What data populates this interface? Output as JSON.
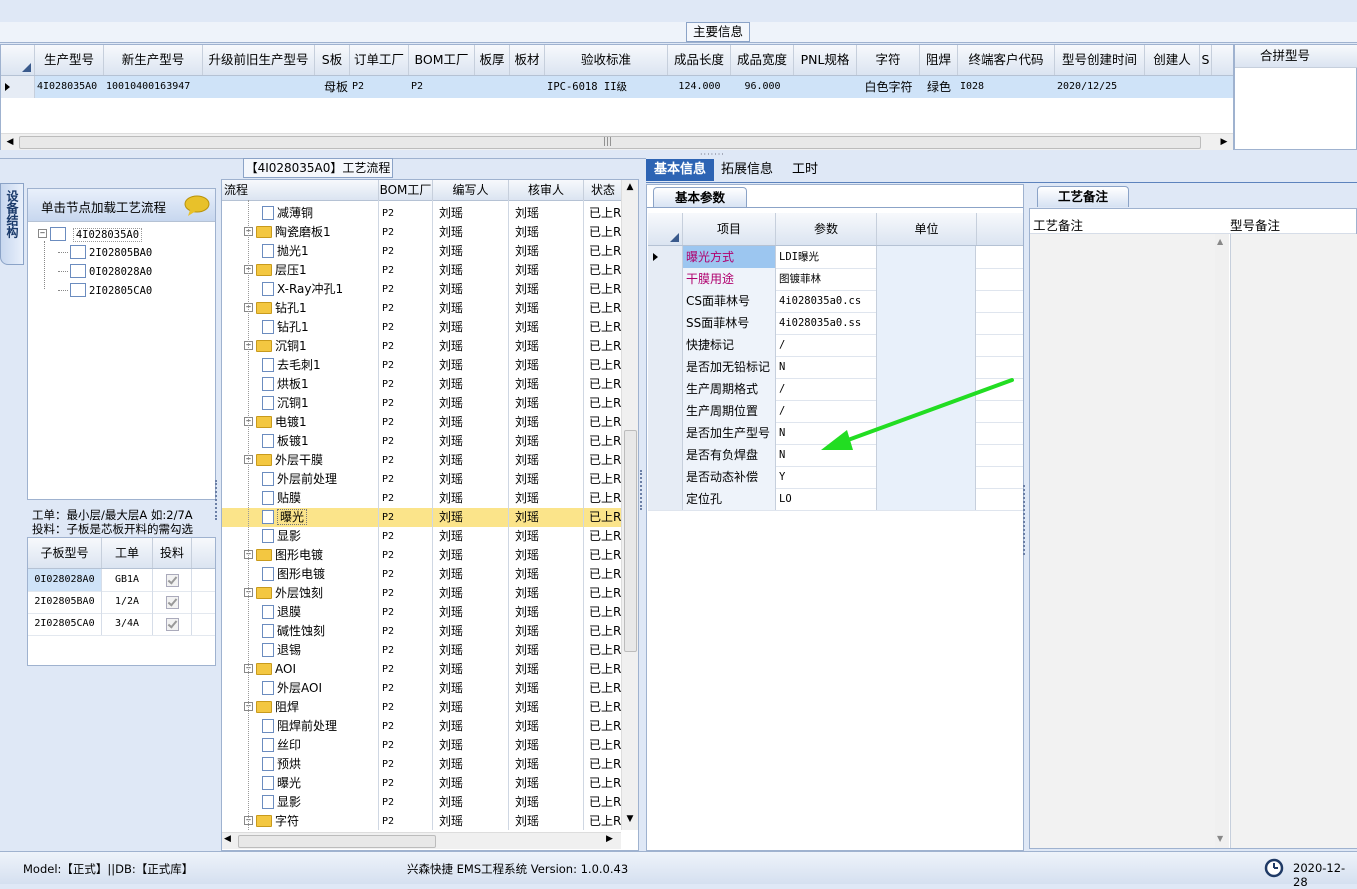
{
  "top": {
    "main_info_label": "主要信息",
    "columns": [
      "生产型号",
      "新生产型号",
      "升级前旧生产型号",
      "S板",
      "订单工厂",
      "BOM工厂",
      "板厚",
      "板材",
      "验收标准",
      "成品长度",
      "成品宽度",
      "PNL规格",
      "字符",
      "阻焊",
      "终端客户代码",
      "型号创建时间",
      "创建人",
      "S"
    ],
    "row": [
      "4I028035A0",
      "10010400163947",
      "",
      "母板",
      "P2",
      "P2",
      "",
      "",
      "IPC-6018 II级",
      "124.000",
      "96.000",
      "",
      "白色字符",
      "绿色",
      "I028",
      "2020/12/25",
      "",
      ""
    ],
    "merge_header": "合拼型号"
  },
  "left": {
    "vertical_tab": "设备结构",
    "hint": "单击节点加载工艺流程",
    "tree_root": "4I028035A0",
    "tree_children": [
      "2I02805BA0",
      "0I028028A0",
      "2I02805CA0"
    ],
    "note_line1": "工单：最小层/最大层A 如:2/7A",
    "note_line2": "投料：子板是芯板开料的需勾选",
    "sub_headers": [
      "子板型号",
      "工单",
      "投料"
    ],
    "sub_rows": [
      {
        "model": "0I028028A0",
        "order": "GB1A"
      },
      {
        "model": "2I02805BA0",
        "order": "1/2A"
      },
      {
        "model": "2I02805CA0",
        "order": "3/4A"
      }
    ]
  },
  "process": {
    "title": "【4I028035A0】工艺流程",
    "headers": [
      "流程",
      "BOM工厂",
      "编写人",
      "核审人",
      "状态"
    ],
    "rows": [
      {
        "kind": "child",
        "name": "减薄铜",
        "bom": "P2",
        "writer": "刘瑶",
        "reviewer": "刘瑶",
        "status": "已上R"
      },
      {
        "kind": "folder",
        "name": "陶瓷磨板1",
        "bom": "P2",
        "writer": "刘瑶",
        "reviewer": "刘瑶",
        "status": "已上R"
      },
      {
        "kind": "child",
        "name": "抛光1",
        "bom": "P2",
        "writer": "刘瑶",
        "reviewer": "刘瑶",
        "status": "已上R"
      },
      {
        "kind": "folder",
        "name": "层压1",
        "bom": "P2",
        "writer": "刘瑶",
        "reviewer": "刘瑶",
        "status": "已上R"
      },
      {
        "kind": "child",
        "name": "X-Ray冲孔1",
        "bom": "P2",
        "writer": "刘瑶",
        "reviewer": "刘瑶",
        "status": "已上R"
      },
      {
        "kind": "folder",
        "name": "钻孔1",
        "bom": "P2",
        "writer": "刘瑶",
        "reviewer": "刘瑶",
        "status": "已上R"
      },
      {
        "kind": "child",
        "name": "钻孔1",
        "bom": "P2",
        "writer": "刘瑶",
        "reviewer": "刘瑶",
        "status": "已上R"
      },
      {
        "kind": "folder",
        "name": "沉铜1",
        "bom": "P2",
        "writer": "刘瑶",
        "reviewer": "刘瑶",
        "status": "已上R"
      },
      {
        "kind": "child",
        "name": "去毛刺1",
        "bom": "P2",
        "writer": "刘瑶",
        "reviewer": "刘瑶",
        "status": "已上R"
      },
      {
        "kind": "child",
        "name": "烘板1",
        "bom": "P2",
        "writer": "刘瑶",
        "reviewer": "刘瑶",
        "status": "已上R"
      },
      {
        "kind": "child",
        "name": "沉铜1",
        "bom": "P2",
        "writer": "刘瑶",
        "reviewer": "刘瑶",
        "status": "已上R"
      },
      {
        "kind": "folder",
        "name": "电镀1",
        "bom": "P2",
        "writer": "刘瑶",
        "reviewer": "刘瑶",
        "status": "已上R"
      },
      {
        "kind": "child",
        "name": "板镀1",
        "bom": "P2",
        "writer": "刘瑶",
        "reviewer": "刘瑶",
        "status": "已上R"
      },
      {
        "kind": "folder",
        "name": "外层干膜",
        "bom": "P2",
        "writer": "刘瑶",
        "reviewer": "刘瑶",
        "status": "已上R"
      },
      {
        "kind": "child",
        "name": "外层前处理",
        "bom": "P2",
        "writer": "刘瑶",
        "reviewer": "刘瑶",
        "status": "已上R"
      },
      {
        "kind": "child",
        "name": "贴膜",
        "bom": "P2",
        "writer": "刘瑶",
        "reviewer": "刘瑶",
        "status": "已上R"
      },
      {
        "kind": "child",
        "name": "曝光",
        "bom": "P2",
        "writer": "刘瑶",
        "reviewer": "刘瑶",
        "status": "已上R"
      },
      {
        "kind": "child",
        "name": "显影",
        "bom": "P2",
        "writer": "刘瑶",
        "reviewer": "刘瑶",
        "status": "已上R"
      },
      {
        "kind": "folder",
        "name": "图形电镀",
        "bom": "P2",
        "writer": "刘瑶",
        "reviewer": "刘瑶",
        "status": "已上R"
      },
      {
        "kind": "child",
        "name": "图形电镀",
        "bom": "P2",
        "writer": "刘瑶",
        "reviewer": "刘瑶",
        "status": "已上R"
      },
      {
        "kind": "folder",
        "name": "外层蚀刻",
        "bom": "P2",
        "writer": "刘瑶",
        "reviewer": "刘瑶",
        "status": "已上R"
      },
      {
        "kind": "child",
        "name": "退膜",
        "bom": "P2",
        "writer": "刘瑶",
        "reviewer": "刘瑶",
        "status": "已上R"
      },
      {
        "kind": "child",
        "name": "碱性蚀刻",
        "bom": "P2",
        "writer": "刘瑶",
        "reviewer": "刘瑶",
        "status": "已上R"
      },
      {
        "kind": "child",
        "name": "退锡",
        "bom": "P2",
        "writer": "刘瑶",
        "reviewer": "刘瑶",
        "status": "已上R"
      },
      {
        "kind": "folder",
        "name": "AOI",
        "bom": "P2",
        "writer": "刘瑶",
        "reviewer": "刘瑶",
        "status": "已上R"
      },
      {
        "kind": "child",
        "name": "外层AOI",
        "bom": "P2",
        "writer": "刘瑶",
        "reviewer": "刘瑶",
        "status": "已上R"
      },
      {
        "kind": "folder",
        "name": "阻焊",
        "bom": "P2",
        "writer": "刘瑶",
        "reviewer": "刘瑶",
        "status": "已上R"
      },
      {
        "kind": "child",
        "name": "阻焊前处理",
        "bom": "P2",
        "writer": "刘瑶",
        "reviewer": "刘瑶",
        "status": "已上R"
      },
      {
        "kind": "child",
        "name": "丝印",
        "bom": "P2",
        "writer": "刘瑶",
        "reviewer": "刘瑶",
        "status": "已上R"
      },
      {
        "kind": "child",
        "name": "预烘",
        "bom": "P2",
        "writer": "刘瑶",
        "reviewer": "刘瑶",
        "status": "已上R"
      },
      {
        "kind": "child",
        "name": "曝光",
        "bom": "P2",
        "writer": "刘瑶",
        "reviewer": "刘瑶",
        "status": "已上R"
      },
      {
        "kind": "child",
        "name": "显影",
        "bom": "P2",
        "writer": "刘瑶",
        "reviewer": "刘瑶",
        "status": "已上R"
      },
      {
        "kind": "folder",
        "name": "字符",
        "bom": "P2",
        "writer": "刘瑶",
        "reviewer": "刘瑶",
        "status": "已上R"
      }
    ],
    "selected_index": 16
  },
  "right": {
    "tabs": [
      "基本信息",
      "拓展信息",
      "工时"
    ],
    "subtab": "基本参数",
    "headers": [
      "项目",
      "参数",
      "单位"
    ],
    "rows": [
      {
        "item": "曝光方式",
        "param": "LDI曝光",
        "highlight": true
      },
      {
        "item": "干膜用途",
        "param": "图镀菲林",
        "highlight": true
      },
      {
        "item": "CS面菲林号",
        "param": "4i028035a0.cs",
        "highlight": false
      },
      {
        "item": "SS面菲林号",
        "param": "4i028035a0.ss",
        "highlight": false
      },
      {
        "item": "快捷标记",
        "param": "/",
        "highlight": false
      },
      {
        "item": "是否加无铅标记",
        "param": "N",
        "highlight": false
      },
      {
        "item": "生产周期格式",
        "param": "/",
        "highlight": false
      },
      {
        "item": "生产周期位置",
        "param": "/",
        "highlight": false
      },
      {
        "item": "是否加生产型号",
        "param": "N",
        "highlight": false
      },
      {
        "item": "是否有负焊盘",
        "param": "N",
        "highlight": false
      },
      {
        "item": "是否动态补偿",
        "param": "Y",
        "highlight": false
      },
      {
        "item": "定位孔",
        "param": "LO",
        "highlight": false
      }
    ],
    "remarks_tab": "工艺备注",
    "remarks_headers": [
      "工艺备注",
      "型号备注"
    ]
  },
  "status": {
    "left": "Model:【正式】||DB:【正式库】",
    "center": "兴森快捷 EMS工程系统 Version: 1.0.0.43",
    "date": "2020-12-28"
  },
  "colors": {
    "accent": "#9cc6f0",
    "highlight_text": "#b0006e",
    "arrow": "#22dd22",
    "selected_row": "#fbe48a"
  }
}
